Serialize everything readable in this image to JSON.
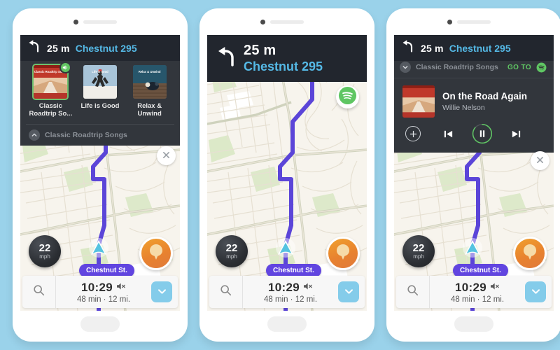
{
  "theme": {
    "background": "#9ad2ea",
    "panel_dark": "#32363c",
    "header_dark": "#22262e",
    "street_blue": "#55b9e6",
    "route_purple": "#5b45d8",
    "spotify_green": "#5fc663",
    "accent_blue": "#84ccea",
    "orange": "#e8822f"
  },
  "navigation": {
    "turn_icon": "turn-left-arrow-icon",
    "distance": "25 m",
    "street": "Chestnut 295"
  },
  "map": {
    "speedometer": {
      "value": "22",
      "unit": "mph"
    },
    "current_street_label": "Chestnut St.",
    "car_marker_icon": "car-direction-arrow-icon",
    "report_button_icon": "report-pin-icon",
    "spotify_fab_icon": "spotify-icon"
  },
  "bottom_bar": {
    "search_icon": "search-icon",
    "arrival_time": "10:29",
    "mute_icon": "speaker-muted-icon",
    "eta": "48 min · 12 mi.",
    "expand_icon": "chevron-down-icon"
  },
  "playlist_panel": {
    "albums": [
      {
        "label": "Classic Roadtrip So...",
        "art_title": "Classic Roadtrip Songs",
        "selected": true,
        "badge_icon": "speaker-playing-icon"
      },
      {
        "label": "Life is Good",
        "art_title": "Life is good",
        "selected": false
      },
      {
        "label": "Relax & Unwind",
        "art_title": "Relax & Unwind",
        "selected": false
      }
    ],
    "footer_label": "Classic Roadtrip Songs",
    "footer_icon": "chevron-up-icon",
    "close_icon": "close-icon"
  },
  "player_panel": {
    "playlist_name": "Classic Roadtrip Songs",
    "collapse_icon": "chevron-down-icon",
    "goto_label": "GO TO",
    "goto_icon": "spotify-icon",
    "album_art_title": "Classic Roadtrip Songs",
    "track_title": "On the Road Again",
    "track_artist": "Willie Nelson",
    "controls": {
      "add_icon": "plus-circle-icon",
      "previous_icon": "previous-track-icon",
      "play_pause_icon": "pause-icon",
      "next_icon": "next-track-icon"
    },
    "close_icon": "close-icon"
  },
  "phones": [
    {
      "id": "phone-playlist-browser"
    },
    {
      "id": "phone-navigation"
    },
    {
      "id": "phone-now-playing"
    }
  ]
}
